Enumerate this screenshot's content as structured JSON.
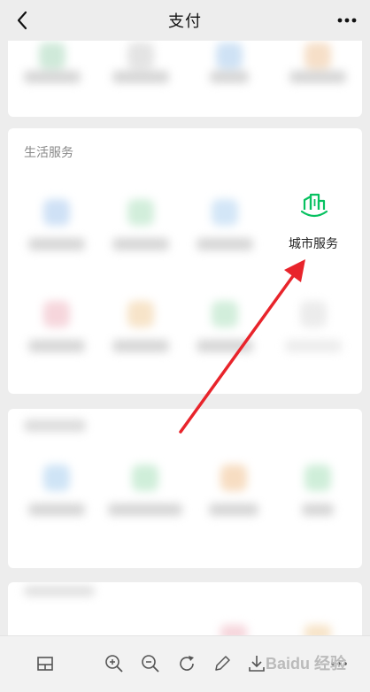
{
  "header": {
    "title": "支付"
  },
  "life_section": {
    "title": "生活服务",
    "highlight": {
      "label": "城市服务",
      "icon": "city-buildings-icon",
      "color": "#07c160"
    }
  },
  "colors": {
    "background": "#ededed",
    "card": "#ffffff",
    "arrow": "#e8242b"
  },
  "toolbar": {
    "icons": [
      "layout-icon",
      "zoom-in-icon",
      "zoom-out-icon",
      "rotate-icon",
      "edit-icon",
      "download-icon",
      "more-icon"
    ]
  },
  "watermark": {
    "text": "Baidu 经验"
  }
}
